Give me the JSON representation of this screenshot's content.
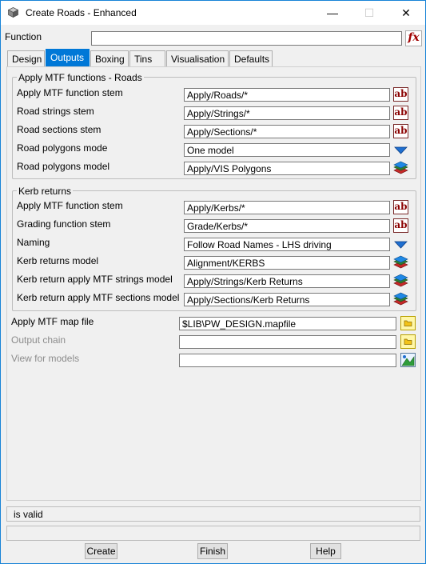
{
  "window": {
    "title": "Create Roads - Enhanced",
    "minimize": "—",
    "maximize": "☐",
    "close": "✕"
  },
  "function_row": {
    "label": "Function",
    "value": "",
    "fx_label": "fx"
  },
  "tabs": [
    {
      "label": "Design"
    },
    {
      "label": "Outputs",
      "active": true
    },
    {
      "label": "Boxing"
    },
    {
      "label": "Tins"
    },
    {
      "label": "Visualisation"
    },
    {
      "label": "Defaults"
    }
  ],
  "roads_group": {
    "title": "Apply MTF functions - Roads",
    "rows": [
      {
        "label": "Apply MTF function stem",
        "value": "Apply/Roads/*",
        "button": "ab"
      },
      {
        "label": "Road strings stem",
        "value": "Apply/Strings/*",
        "button": "ab"
      },
      {
        "label": "Road sections stem",
        "value": "Apply/Sections/*",
        "button": "ab"
      },
      {
        "label": "Road polygons mode",
        "value": "One model",
        "button": "dropdown"
      },
      {
        "label": "Road polygons model",
        "value": "Apply/VIS Polygons",
        "button": "model"
      }
    ]
  },
  "kerb_group": {
    "title": "Kerb returns",
    "rows": [
      {
        "label": "Apply MTF function stem",
        "value": "Apply/Kerbs/*",
        "button": "ab"
      },
      {
        "label": "Grading function stem",
        "value": "Grade/Kerbs/*",
        "button": "ab"
      },
      {
        "label": "Naming",
        "value": "Follow Road Names - LHS driving",
        "button": "dropdown"
      },
      {
        "label": "Kerb returns model",
        "value": "Alignment/KERBS",
        "button": "model"
      },
      {
        "label": "Kerb return apply MTF strings model",
        "value": "Apply/Strings/Kerb Returns",
        "button": "model"
      },
      {
        "label": "Kerb return apply MTF sections model",
        "value": "Apply/Sections/Kerb Returns",
        "button": "model"
      }
    ]
  },
  "lower_rows": [
    {
      "label": "Apply MTF map file",
      "value": "$LIB\\PW_DESIGN.mapfile",
      "button": "folder",
      "enabled": true
    },
    {
      "label": "Output chain",
      "value": "",
      "button": "folder",
      "enabled": false
    },
    {
      "label": "View for models",
      "value": "",
      "button": "view",
      "enabled": false
    }
  ],
  "status": {
    "message": "is valid",
    "secondary": ""
  },
  "buttons": {
    "create": "Create",
    "finish": "Finish",
    "help": "Help"
  }
}
